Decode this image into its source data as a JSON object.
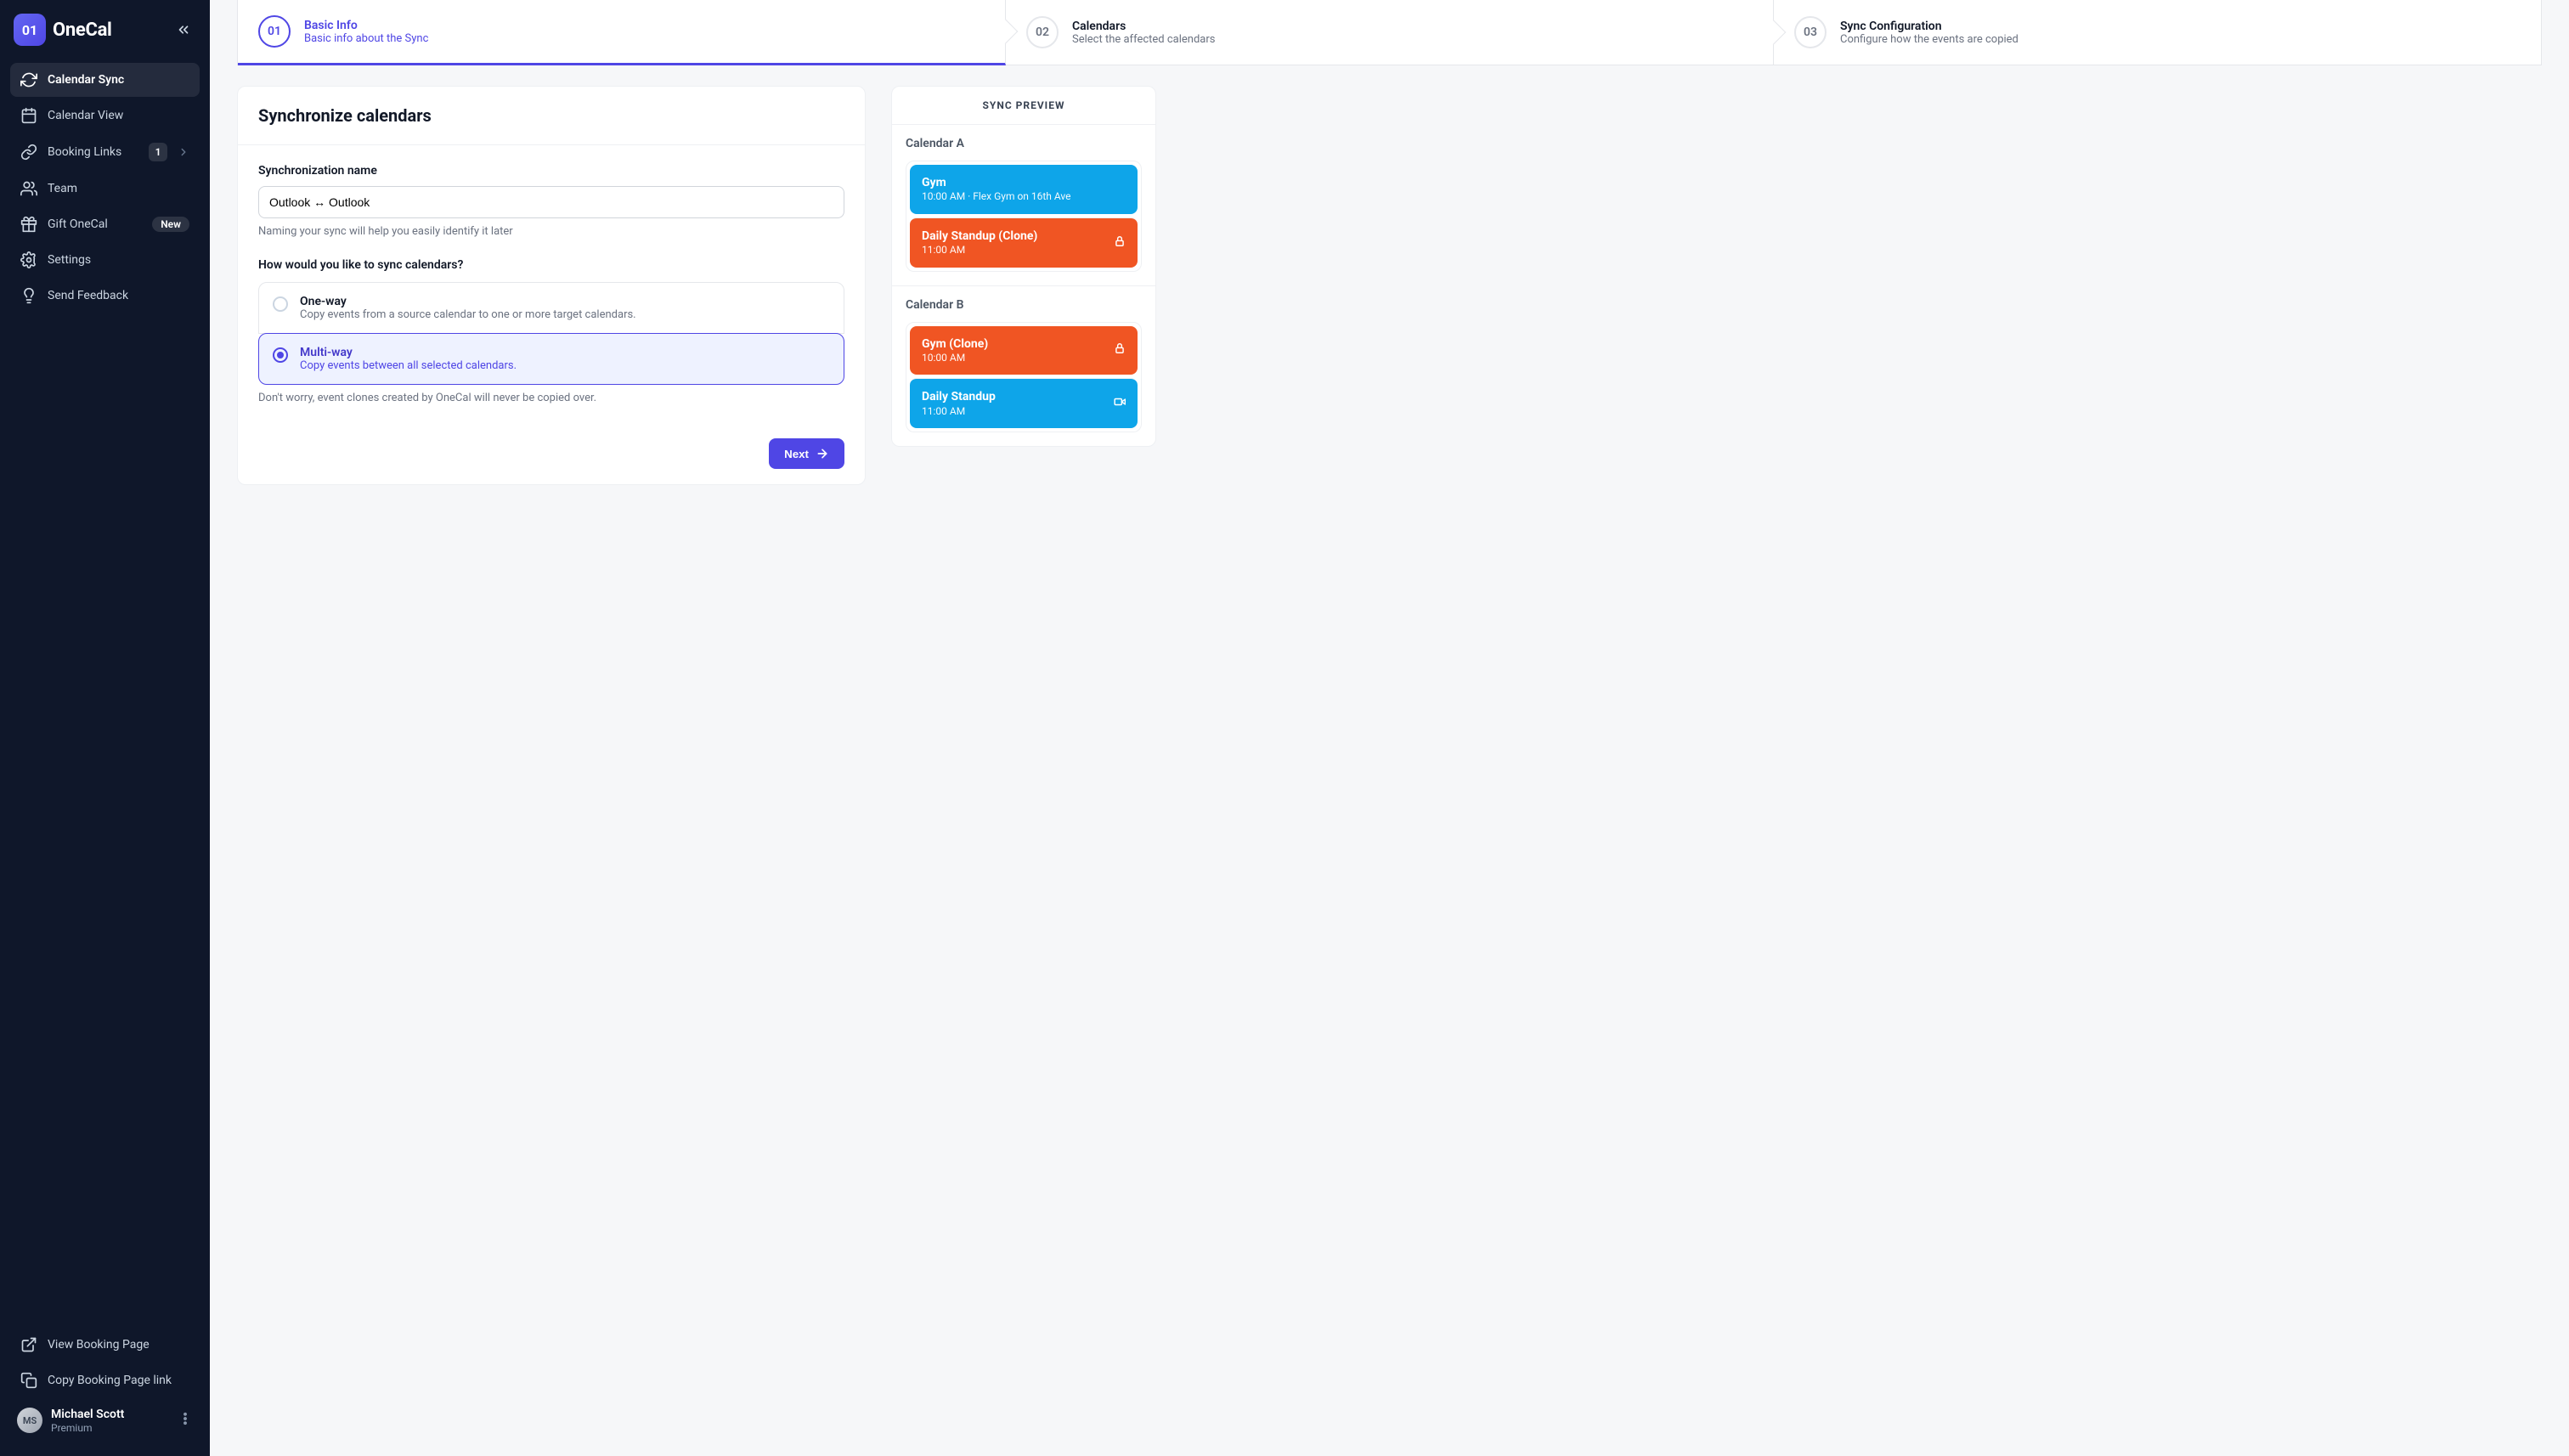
{
  "brand": {
    "mark": "01",
    "name": "OneCal"
  },
  "sidebar": {
    "items": [
      {
        "label": "Calendar Sync"
      },
      {
        "label": "Calendar View"
      },
      {
        "label": "Booking Links",
        "count": "1"
      },
      {
        "label": "Team"
      },
      {
        "label": "Gift OneCal",
        "badge": "New"
      },
      {
        "label": "Settings"
      },
      {
        "label": "Send Feedback"
      }
    ],
    "bottom": [
      {
        "label": "View Booking Page"
      },
      {
        "label": "Copy Booking Page link"
      }
    ],
    "user": {
      "name": "Michael Scott",
      "plan": "Premium",
      "initials": "MS"
    }
  },
  "stepper": [
    {
      "num": "01",
      "title": "Basic Info",
      "sub": "Basic info about the Sync"
    },
    {
      "num": "02",
      "title": "Calendars",
      "sub": "Select the affected calendars"
    },
    {
      "num": "03",
      "title": "Sync Configuration",
      "sub": "Configure how the events are copied"
    }
  ],
  "form": {
    "card_title": "Synchronize calendars",
    "name_label": "Synchronization name",
    "name_value": "Outlook ↔ Outlook",
    "name_help": "Naming your sync will help you easily identify it later",
    "sync_mode_label": "How would you like to sync calendars?",
    "modes": {
      "oneway": {
        "title": "One-way",
        "sub": "Copy events from a source calendar to one or more target calendars."
      },
      "multiway": {
        "title": "Multi-way",
        "sub": "Copy events between all selected calendars."
      }
    },
    "modes_help": "Don't worry, event clones created by OneCal will never be copied over.",
    "next": "Next"
  },
  "preview": {
    "title": "SYNC PREVIEW",
    "cal_a": {
      "label": "Calendar A",
      "events": [
        {
          "title": "Gym",
          "sub": "10:00 AM  ·  Flex Gym on 16th Ave",
          "color": "blue",
          "icon": null
        },
        {
          "title": "Daily Standup (Clone)",
          "sub": "11:00 AM",
          "color": "orange",
          "icon": "lock"
        }
      ]
    },
    "cal_b": {
      "label": "Calendar B",
      "events": [
        {
          "title": "Gym (Clone)",
          "sub": "10:00 AM",
          "color": "orange",
          "icon": "lock"
        },
        {
          "title": "Daily Standup",
          "sub": "11:00 AM",
          "color": "blue",
          "icon": "video"
        }
      ]
    }
  }
}
